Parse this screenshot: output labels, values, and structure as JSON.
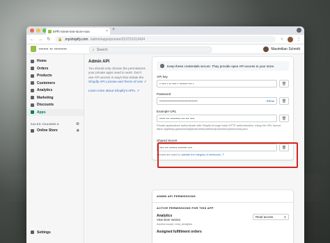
{
  "browser": {
    "tab_title": "EPfh-street-test-store-mas",
    "tab_close": "×",
    "new_tab": "+",
    "url_host": ".myshopify.com",
    "url_path": "/admin/apps/private/319721013434",
    "nav_back": "←",
    "nav_forward": "→",
    "nav_reload": "↻",
    "lock_icon": "🔒",
    "star_icon": "☆",
    "menu_icon": "⋮",
    "traffic_lights": [
      "#ed6a5e",
      "#f5bf4f",
      "#61c554"
    ]
  },
  "topbar": {
    "store_name": "▪▪▪▪▪▪  ▪▪ ▪▪▪▪▪▪▪▪",
    "search_placeholder": "Search",
    "search_icon": "⌕",
    "user_name": "Maximilian Schmitt"
  },
  "sidebar": {
    "items": [
      {
        "label": "Home"
      },
      {
        "label": "Orders"
      },
      {
        "label": "Products"
      },
      {
        "label": "Customers"
      },
      {
        "label": "Analytics"
      },
      {
        "label": "Marketing"
      },
      {
        "label": "Discounts"
      },
      {
        "label": "Apps"
      }
    ],
    "sales_channels_label": "SALES CHANNELS",
    "sales_channels_add": "⊕",
    "online_store_label": "Online Store",
    "online_store_eye": "◉",
    "settings_label": "Settings"
  },
  "main": {
    "heading": "Admin API",
    "desc_before_link": "You should only choose the permissions your private apps need to work. Don't use API access in ways that violate the ",
    "desc_link": "Shopify API License and Terms of Use",
    "desc_link_icon": "↗",
    "learn_more": "Learn more about Shopify's APIs.",
    "learn_more_icon": "↗",
    "banner_text": "Keep these credentials secure. They provide open API access to your store.",
    "info_icon": "i",
    "api_key_label": "API key",
    "api_key_value": "▪ ▪▪▪▪ ▪ ▪▪  ▪▪▪▪ ▪  ▪▪▪▪▪▪▪ ▪▪▪ ▪",
    "password_label": "Password",
    "password_value": "••••••••••••••••••••••••••••••••••",
    "show_label": "Show",
    "example_url_label": "Example URL",
    "example_url_value": "▪▪▪▪▪ ▪▪▪ ▪▪▪▪▪▪▪▪▪ ▪▪▪ ▪▪▪ ▪▪▪▪",
    "example_url_help": "Private applications authenticate with Shopify through basic HTTP authentication, using the URL format https://{apikey}:{password}@{hostname}/admin/api/{version}/{resource}.json",
    "shared_secret_label": "Shared Secret",
    "shared_secret_value": "▪▪▪▪ ▪▪▪ ▪▪▪▪▪▪▪  ▪▪▪▪▪▪▪▪ ▪▪▪▪",
    "shared_secret_help_prefix": "Secrets are used to ",
    "shared_secret_help_link": "validate the integrity of webhooks",
    "shared_secret_help_icon": "↗",
    "trash_icon": "🗑"
  },
  "permissions": {
    "heading": "ADMIN API PERMISSIONS",
    "active_label": "ACTIVE PERMISSIONS FOR THIS APP",
    "analytics_title": "Analytics",
    "analytics_desc": "View store metrics",
    "analytics_scope": "Access scope: read_analytics",
    "analytics_select": "Read access",
    "select_caret": "⬍",
    "next_title": "Assigned fulfillment orders"
  }
}
